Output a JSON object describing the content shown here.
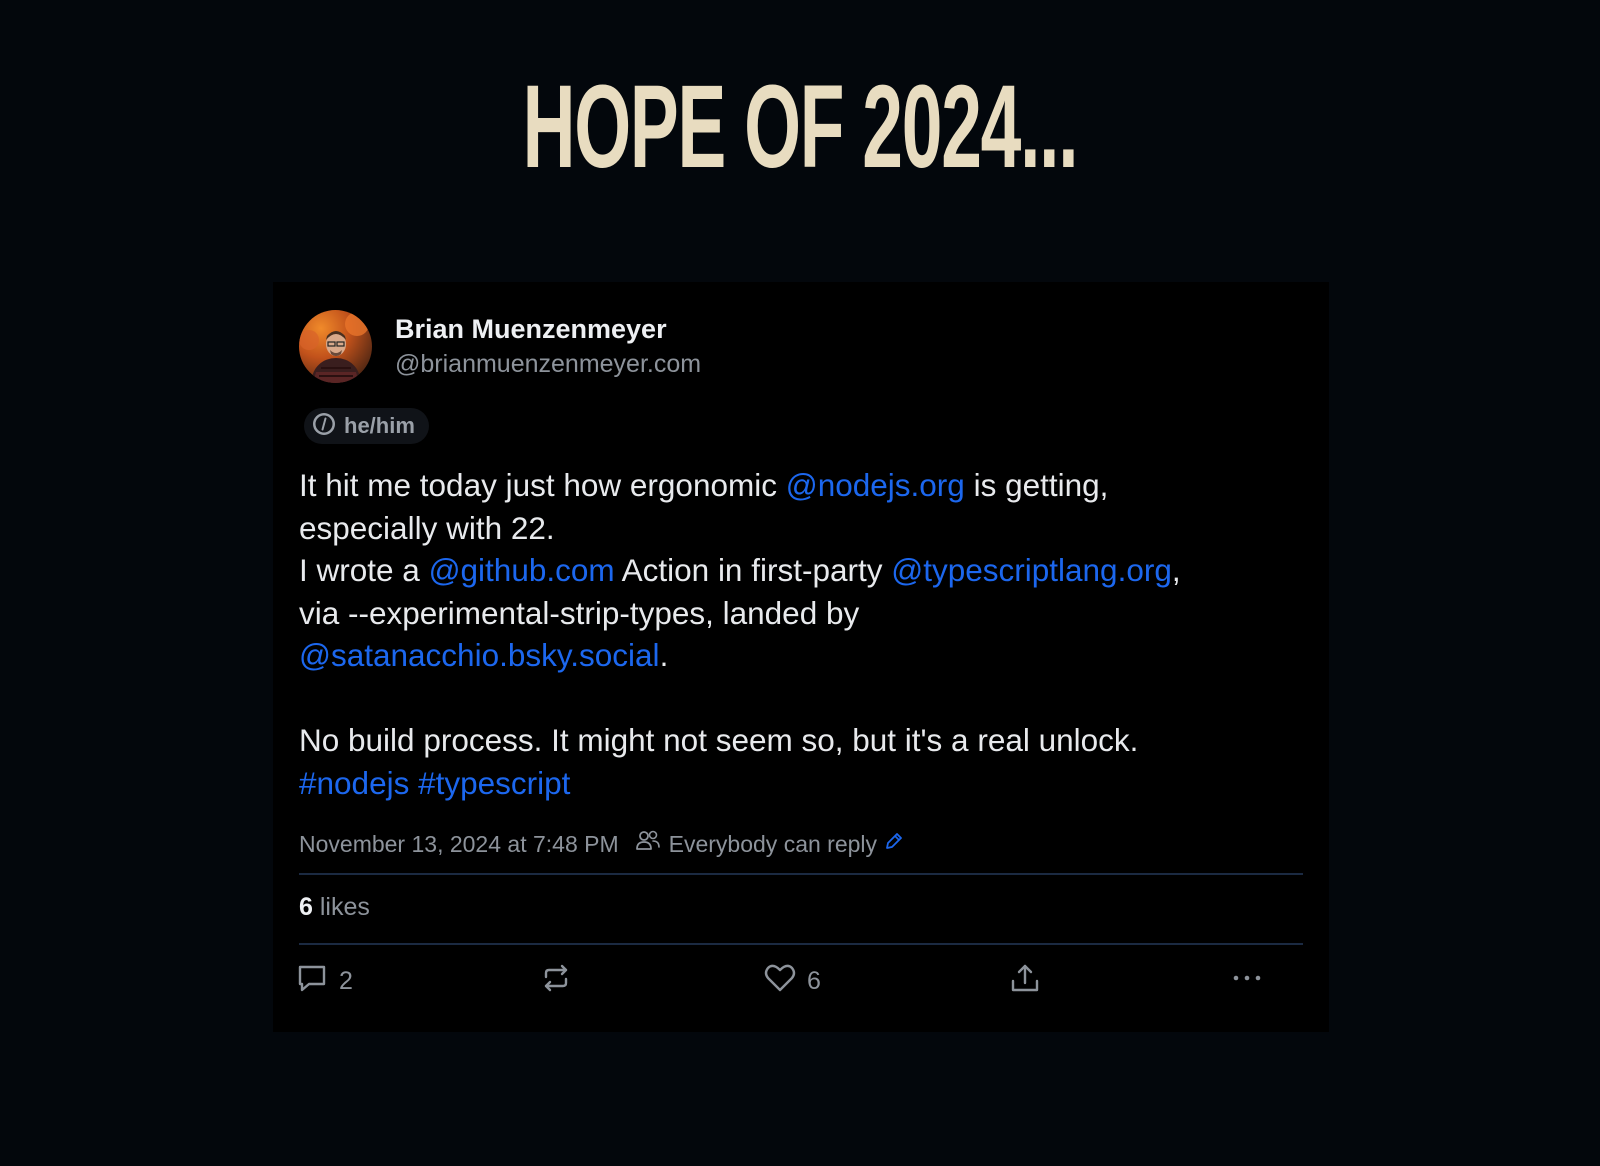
{
  "slide": {
    "title": "HOPE OF 2024..."
  },
  "post": {
    "author": {
      "display_name": "Brian Muenzenmeyer",
      "handle": "@brianmuenzenmeyer.com",
      "pronouns": "he/him"
    },
    "body": {
      "line1_text": "It hit me today just how ergonomic ",
      "mention_nodejs": "@nodejs.org",
      "line1_tail": " is getting,",
      "line2": "especially with 22.",
      "line3_text": "I wrote a ",
      "mention_github": "@github.com",
      "line3_mid": " Action in first-party ",
      "mention_typescript": "@typescriptlang.org",
      "line3_tail": ",",
      "line4": "via --experimental-strip-types, landed by",
      "mention_satanacchio": "@satanacchio.bsky.social",
      "line5_tail": ".",
      "line6": "No build process. It might not seem so, but it's a real unlock.",
      "hashtag_nodejs": "#nodejs",
      "hashtag_typescript": "#typescript"
    },
    "timestamp": "November 13, 2024 at 7:48 PM",
    "reply_setting": "Everybody can reply",
    "likes": {
      "count": "6",
      "label": "likes"
    },
    "actions": {
      "reply_count": "2",
      "like_count": "6"
    }
  },
  "colors": {
    "background": "#03070c",
    "title": "#e8dcc0",
    "link": "#1c67ee",
    "text": "#e8eaed",
    "muted": "#8d939b"
  },
  "icons": [
    "pronouns-icon",
    "people-icon",
    "edit-pencil-icon",
    "reply-icon",
    "repost-icon",
    "heart-icon",
    "share-icon",
    "more-icon"
  ]
}
